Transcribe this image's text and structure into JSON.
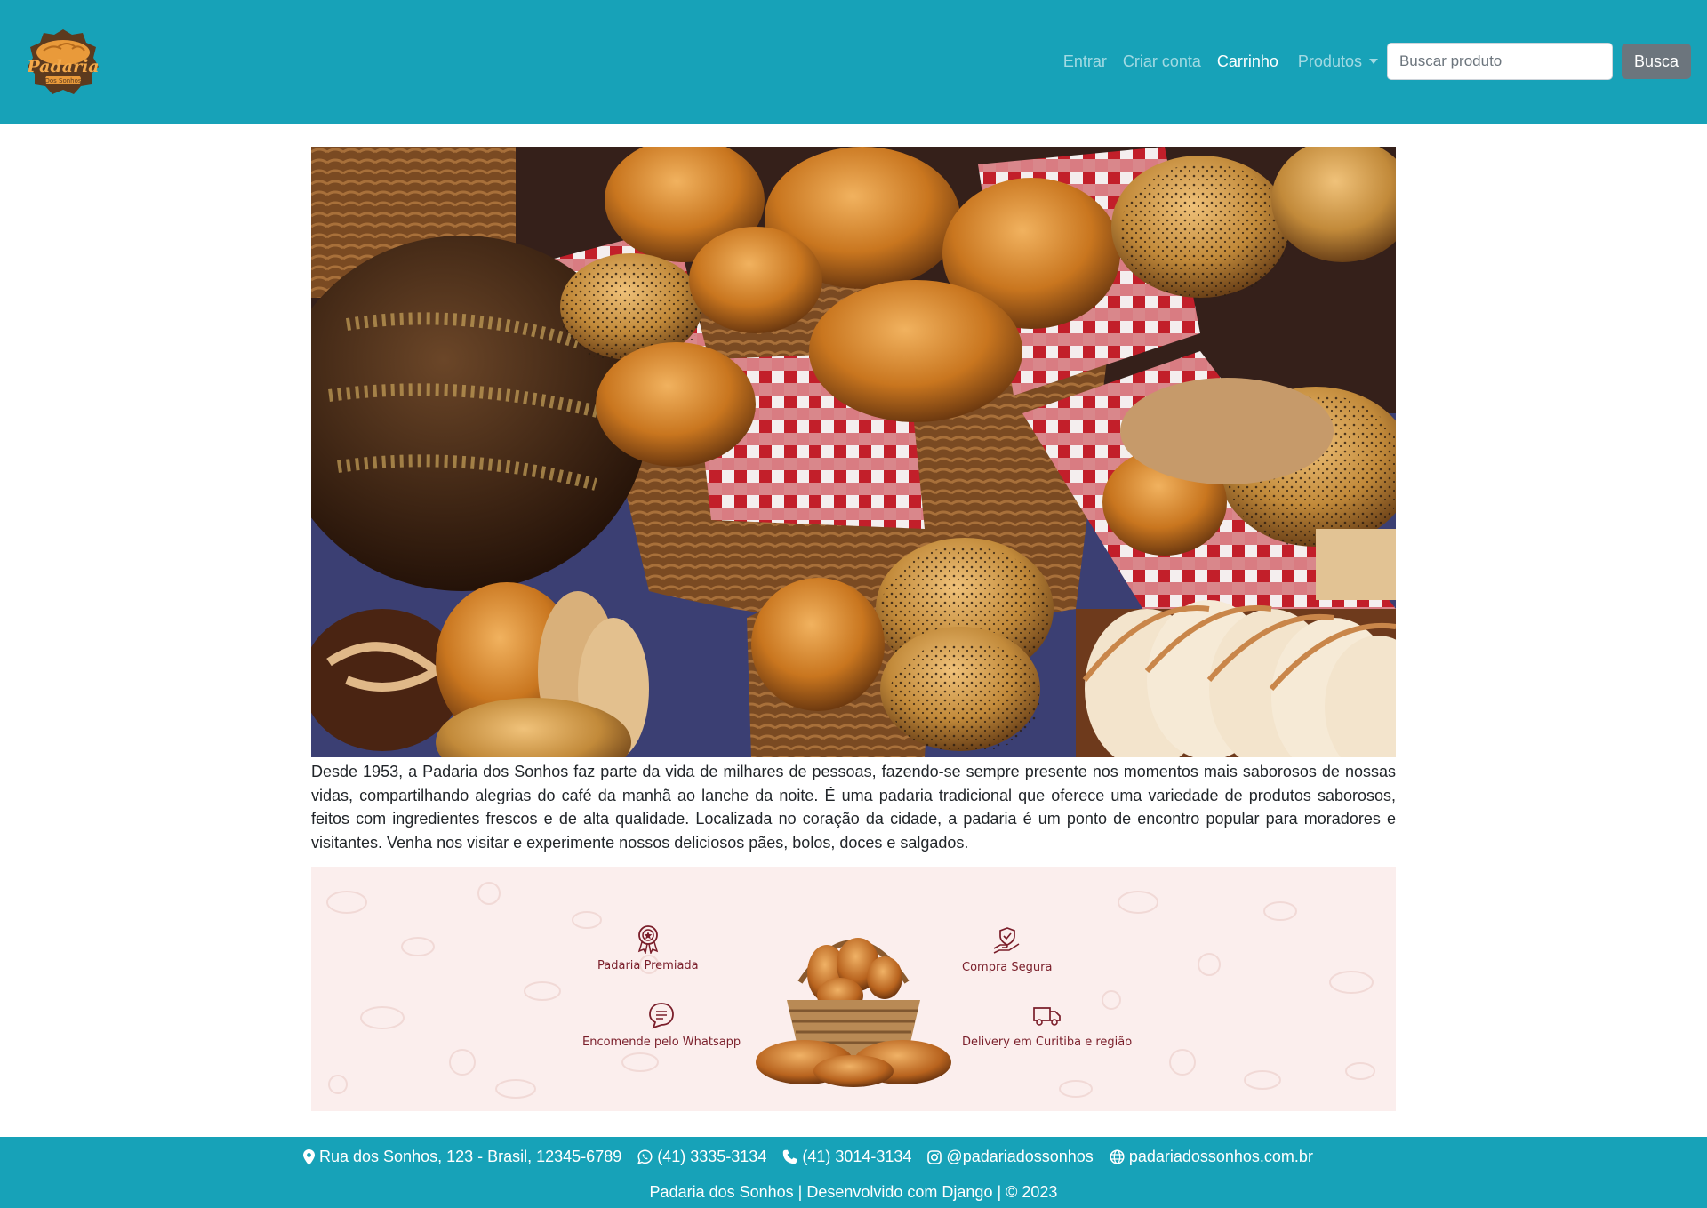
{
  "navbar": {
    "logo_text": "Padaria",
    "logo_subtext": "Dos Sonhos",
    "links": {
      "login": "Entrar",
      "signup": "Criar conta",
      "cart": "Carrinho",
      "products": "Produtos"
    },
    "search": {
      "placeholder": "Buscar produto",
      "button": "Busca"
    }
  },
  "hero": {
    "description": "Desde 1953, a Padaria dos Sonhos faz parte da vida de milhares de pessoas, fazendo-se sempre presente nos momentos mais saborosos de nossas vidas, compartilhando alegrias do café da manhã ao lanche da noite. É uma padaria tradicional que oferece uma variedade de produtos saborosos, feitos com ingredientes frescos e de alta qualidade. Localizada no coração da cidade, a padaria é um ponto de encontro popular para moradores e visitantes. Venha nos visitar e experimente nossos deliciosos pães, bolos, doces e salgados."
  },
  "features": {
    "award": "Padaria Premiada",
    "secure": "Compra Segura",
    "whatsapp": "Encomende pelo Whatsapp",
    "delivery": "Delivery em Curitiba e região"
  },
  "footer": {
    "address": "Rua dos Sonhos, 123 - Brasil, 12345-6789",
    "whatsapp": "(41) 3335-3134",
    "phone": "(41) 3014-3134",
    "instagram": "@padariadossonhos",
    "website": "padariadossonhos.com.br",
    "copyright": "Padaria dos Sonhos | Desenvolvido com Django | © 2023"
  },
  "colors": {
    "primary": "#17a2b8",
    "secondary_button": "#6c757d",
    "feature_text": "#7a1e2a",
    "feature_bg": "#fbeeed"
  }
}
